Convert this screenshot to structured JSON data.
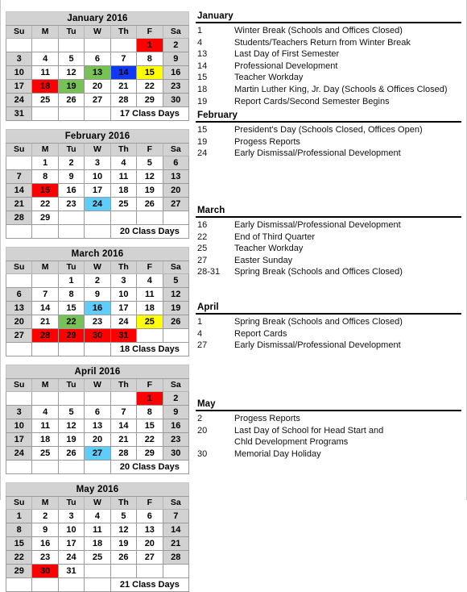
{
  "title": "2016 School Calendar January-May",
  "colors": {
    "holiday_red": "#fe0000",
    "green": "#76c255",
    "blue": "#1139f5",
    "yellow": "#ffff00",
    "light_blue": "#5fcdf7",
    "header_gray": "#d2d2d2"
  },
  "dow": [
    "Su",
    "M",
    "Tu",
    "W",
    "Th",
    "F",
    "Sa"
  ],
  "months": [
    {
      "title": "January 2016",
      "class_days": "17 Class Days",
      "weeks": [
        [
          {
            "d": "",
            "t": "empty"
          },
          {
            "d": "",
            "t": "empty"
          },
          {
            "d": "",
            "t": "empty"
          },
          {
            "d": "",
            "t": "empty"
          },
          {
            "d": "",
            "t": "empty"
          },
          {
            "d": "1",
            "t": "red"
          },
          {
            "d": "2",
            "t": "we"
          }
        ],
        [
          {
            "d": "3",
            "t": "we"
          },
          {
            "d": "4",
            "t": ""
          },
          {
            "d": "5",
            "t": ""
          },
          {
            "d": "6",
            "t": ""
          },
          {
            "d": "7",
            "t": ""
          },
          {
            "d": "8",
            "t": ""
          },
          {
            "d": "9",
            "t": "we"
          }
        ],
        [
          {
            "d": "10",
            "t": "we"
          },
          {
            "d": "11",
            "t": ""
          },
          {
            "d": "12",
            "t": ""
          },
          {
            "d": "13",
            "t": "green"
          },
          {
            "d": "14",
            "t": "blue"
          },
          {
            "d": "15",
            "t": "yellow"
          },
          {
            "d": "16",
            "t": "we"
          }
        ],
        [
          {
            "d": "17",
            "t": "we"
          },
          {
            "d": "18",
            "t": "red"
          },
          {
            "d": "19",
            "t": "green"
          },
          {
            "d": "20",
            "t": ""
          },
          {
            "d": "21",
            "t": ""
          },
          {
            "d": "22",
            "t": ""
          },
          {
            "d": "23",
            "t": "we"
          }
        ],
        [
          {
            "d": "24",
            "t": "we"
          },
          {
            "d": "25",
            "t": ""
          },
          {
            "d": "26",
            "t": ""
          },
          {
            "d": "27",
            "t": ""
          },
          {
            "d": "28",
            "t": ""
          },
          {
            "d": "29",
            "t": ""
          },
          {
            "d": "30",
            "t": "we"
          }
        ],
        [
          {
            "d": "31",
            "t": "we"
          },
          {
            "d": "",
            "t": ""
          },
          {
            "d": "",
            "t": ""
          },
          {
            "d": "",
            "t": ""
          },
          {
            "d": "CLASSDAYS",
            "t": "cd"
          }
        ]
      ]
    },
    {
      "title": "February 2016",
      "class_days": "20 Class Days",
      "weeks": [
        [
          {
            "d": "",
            "t": "empty"
          },
          {
            "d": "1",
            "t": ""
          },
          {
            "d": "2",
            "t": ""
          },
          {
            "d": "3",
            "t": ""
          },
          {
            "d": "4",
            "t": ""
          },
          {
            "d": "5",
            "t": ""
          },
          {
            "d": "6",
            "t": "we"
          }
        ],
        [
          {
            "d": "7",
            "t": "we"
          },
          {
            "d": "8",
            "t": ""
          },
          {
            "d": "9",
            "t": ""
          },
          {
            "d": "10",
            "t": ""
          },
          {
            "d": "11",
            "t": ""
          },
          {
            "d": "12",
            "t": ""
          },
          {
            "d": "13",
            "t": "we"
          }
        ],
        [
          {
            "d": "14",
            "t": "we"
          },
          {
            "d": "15",
            "t": "red"
          },
          {
            "d": "16",
            "t": ""
          },
          {
            "d": "17",
            "t": ""
          },
          {
            "d": "18",
            "t": ""
          },
          {
            "d": "19",
            "t": ""
          },
          {
            "d": "20",
            "t": "we"
          }
        ],
        [
          {
            "d": "21",
            "t": "we"
          },
          {
            "d": "22",
            "t": ""
          },
          {
            "d": "23",
            "t": ""
          },
          {
            "d": "24",
            "t": "ltblue"
          },
          {
            "d": "25",
            "t": ""
          },
          {
            "d": "26",
            "t": ""
          },
          {
            "d": "27",
            "t": "we"
          }
        ],
        [
          {
            "d": "28",
            "t": "we"
          },
          {
            "d": "29",
            "t": ""
          },
          {
            "d": "",
            "t": ""
          },
          {
            "d": "",
            "t": ""
          },
          {
            "d": "",
            "t": ""
          },
          {
            "d": "",
            "t": ""
          },
          {
            "d": "",
            "t": ""
          }
        ],
        [
          {
            "d": "",
            "t": ""
          },
          {
            "d": "",
            "t": ""
          },
          {
            "d": "",
            "t": ""
          },
          {
            "d": "",
            "t": ""
          },
          {
            "d": "CLASSDAYS",
            "t": "cd"
          }
        ]
      ]
    },
    {
      "title": "March 2016",
      "class_days": "18 Class Days",
      "weeks": [
        [
          {
            "d": "",
            "t": "empty"
          },
          {
            "d": "",
            "t": "empty"
          },
          {
            "d": "1",
            "t": ""
          },
          {
            "d": "2",
            "t": ""
          },
          {
            "d": "3",
            "t": ""
          },
          {
            "d": "4",
            "t": ""
          },
          {
            "d": "5",
            "t": "we"
          }
        ],
        [
          {
            "d": "6",
            "t": "we"
          },
          {
            "d": "7",
            "t": ""
          },
          {
            "d": "8",
            "t": ""
          },
          {
            "d": "9",
            "t": ""
          },
          {
            "d": "10",
            "t": ""
          },
          {
            "d": "11",
            "t": ""
          },
          {
            "d": "12",
            "t": "we"
          }
        ],
        [
          {
            "d": "13",
            "t": "we"
          },
          {
            "d": "14",
            "t": ""
          },
          {
            "d": "15",
            "t": ""
          },
          {
            "d": "16",
            "t": "ltblue"
          },
          {
            "d": "17",
            "t": ""
          },
          {
            "d": "18",
            "t": ""
          },
          {
            "d": "19",
            "t": "we"
          }
        ],
        [
          {
            "d": "20",
            "t": "we"
          },
          {
            "d": "21",
            "t": ""
          },
          {
            "d": "22",
            "t": "green"
          },
          {
            "d": "23",
            "t": ""
          },
          {
            "d": "24",
            "t": ""
          },
          {
            "d": "25",
            "t": "yellow"
          },
          {
            "d": "26",
            "t": "we"
          }
        ],
        [
          {
            "d": "27",
            "t": "we"
          },
          {
            "d": "28",
            "t": "red"
          },
          {
            "d": "29",
            "t": "red"
          },
          {
            "d": "30",
            "t": "red"
          },
          {
            "d": "31",
            "t": "red"
          },
          {
            "d": "",
            "t": ""
          },
          {
            "d": "",
            "t": ""
          }
        ],
        [
          {
            "d": "",
            "t": ""
          },
          {
            "d": "",
            "t": ""
          },
          {
            "d": "",
            "t": ""
          },
          {
            "d": "",
            "t": ""
          },
          {
            "d": "CLASSDAYS",
            "t": "cd"
          }
        ]
      ]
    },
    {
      "title": "April 2016",
      "class_days": "20 Class Days",
      "weeks": [
        [
          {
            "d": "",
            "t": "empty"
          },
          {
            "d": "",
            "t": "empty"
          },
          {
            "d": "",
            "t": "empty"
          },
          {
            "d": "",
            "t": "empty"
          },
          {
            "d": "",
            "t": "empty"
          },
          {
            "d": "1",
            "t": "red"
          },
          {
            "d": "2",
            "t": "we"
          }
        ],
        [
          {
            "d": "3",
            "t": "we"
          },
          {
            "d": "4",
            "t": ""
          },
          {
            "d": "5",
            "t": ""
          },
          {
            "d": "6",
            "t": ""
          },
          {
            "d": "7",
            "t": ""
          },
          {
            "d": "8",
            "t": ""
          },
          {
            "d": "9",
            "t": "we"
          }
        ],
        [
          {
            "d": "10",
            "t": "we"
          },
          {
            "d": "11",
            "t": ""
          },
          {
            "d": "12",
            "t": ""
          },
          {
            "d": "13",
            "t": ""
          },
          {
            "d": "14",
            "t": ""
          },
          {
            "d": "15",
            "t": ""
          },
          {
            "d": "16",
            "t": "we"
          }
        ],
        [
          {
            "d": "17",
            "t": "we"
          },
          {
            "d": "18",
            "t": ""
          },
          {
            "d": "19",
            "t": ""
          },
          {
            "d": "20",
            "t": ""
          },
          {
            "d": "21",
            "t": ""
          },
          {
            "d": "22",
            "t": ""
          },
          {
            "d": "23",
            "t": "we"
          }
        ],
        [
          {
            "d": "24",
            "t": "we"
          },
          {
            "d": "25",
            "t": ""
          },
          {
            "d": "26",
            "t": ""
          },
          {
            "d": "27",
            "t": "ltblue"
          },
          {
            "d": "28",
            "t": ""
          },
          {
            "d": "29",
            "t": ""
          },
          {
            "d": "30",
            "t": "we"
          }
        ],
        [
          {
            "d": "",
            "t": ""
          },
          {
            "d": "",
            "t": ""
          },
          {
            "d": "",
            "t": ""
          },
          {
            "d": "",
            "t": ""
          },
          {
            "d": "CLASSDAYS",
            "t": "cd"
          }
        ]
      ]
    },
    {
      "title": "May 2016",
      "class_days": "21 Class Days",
      "weeks": [
        [
          {
            "d": "1",
            "t": "we"
          },
          {
            "d": "2",
            "t": ""
          },
          {
            "d": "3",
            "t": ""
          },
          {
            "d": "4",
            "t": ""
          },
          {
            "d": "5",
            "t": ""
          },
          {
            "d": "6",
            "t": ""
          },
          {
            "d": "7",
            "t": "we"
          }
        ],
        [
          {
            "d": "8",
            "t": "we"
          },
          {
            "d": "9",
            "t": ""
          },
          {
            "d": "10",
            "t": ""
          },
          {
            "d": "11",
            "t": ""
          },
          {
            "d": "12",
            "t": ""
          },
          {
            "d": "13",
            "t": ""
          },
          {
            "d": "14",
            "t": "we"
          }
        ],
        [
          {
            "d": "15",
            "t": "we"
          },
          {
            "d": "16",
            "t": ""
          },
          {
            "d": "17",
            "t": ""
          },
          {
            "d": "18",
            "t": ""
          },
          {
            "d": "19",
            "t": ""
          },
          {
            "d": "20",
            "t": ""
          },
          {
            "d": "21",
            "t": "we"
          }
        ],
        [
          {
            "d": "22",
            "t": "we"
          },
          {
            "d": "23",
            "t": ""
          },
          {
            "d": "24",
            "t": ""
          },
          {
            "d": "25",
            "t": ""
          },
          {
            "d": "26",
            "t": ""
          },
          {
            "d": "27",
            "t": ""
          },
          {
            "d": "28",
            "t": "we"
          }
        ],
        [
          {
            "d": "29",
            "t": "we"
          },
          {
            "d": "30",
            "t": "red"
          },
          {
            "d": "31",
            "t": ""
          },
          {
            "d": "",
            "t": ""
          },
          {
            "d": "",
            "t": ""
          },
          {
            "d": "",
            "t": ""
          },
          {
            "d": "",
            "t": ""
          }
        ],
        [
          {
            "d": "",
            "t": ""
          },
          {
            "d": "",
            "t": ""
          },
          {
            "d": "",
            "t": ""
          },
          {
            "d": "",
            "t": ""
          },
          {
            "d": "CLASSDAYS",
            "t": "cd"
          }
        ]
      ]
    }
  ],
  "events": [
    {
      "month": "January",
      "items": [
        {
          "date": "1",
          "text": "Winter Break (Schools and Offices Closed)"
        },
        {
          "date": "4",
          "text": "Students/Teachers Return from Winter Break"
        },
        {
          "date": "13",
          "text": "Last Day of First Semester"
        },
        {
          "date": "14",
          "text": "Professional Development"
        },
        {
          "date": "15",
          "text": "Teacher Workday"
        },
        {
          "date": "18",
          "text": "Martin Luther King, Jr. Day (Schools & Offices Closed)"
        },
        {
          "date": "19",
          "text": "Report Cards/Second Semester Begins"
        }
      ]
    },
    {
      "month": "February",
      "items": [
        {
          "date": "15",
          "text": "President's Day (Schools Closed, Offices Open)"
        },
        {
          "date": "19",
          "text": "Progess Reports"
        },
        {
          "date": "24",
          "text": "Early Dismissal/Professional Development"
        }
      ]
    },
    {
      "month": "March",
      "items": [
        {
          "date": "16",
          "text": "Early Dismissal/Professional Development"
        },
        {
          "date": "22",
          "text": "End of Third Quarter"
        },
        {
          "date": "25",
          "text": "Teacher Workday"
        },
        {
          "date": "27",
          "text": "Easter Sunday"
        },
        {
          "date": "28-31",
          "text": "Spring Break (Schools and Offices Closed)"
        }
      ]
    },
    {
      "month": "April",
      "items": [
        {
          "date": "1",
          "text": "Spring Break (Schools and Offices Closed)"
        },
        {
          "date": "4",
          "text": "Report Cards"
        },
        {
          "date": "27",
          "text": "Early Dismissal/Professional Development"
        }
      ]
    },
    {
      "month": "May",
      "items": [
        {
          "date": "2",
          "text": "Progess Reports"
        },
        {
          "date": "20",
          "text": "Last Day of School for Head Start and"
        },
        {
          "date": "",
          "text": "Chld Development Programs",
          "cont": true
        },
        {
          "date": "30",
          "text": "Memorial Day Holiday"
        }
      ]
    }
  ]
}
